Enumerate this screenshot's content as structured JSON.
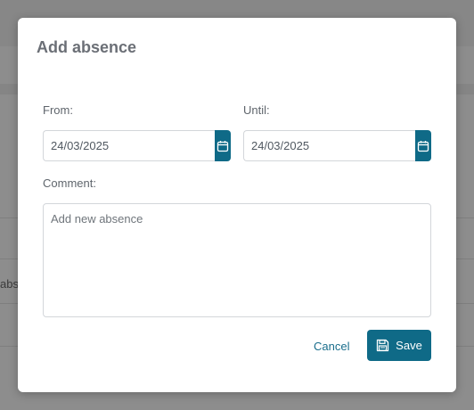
{
  "background": {
    "row_text": "abse"
  },
  "dialog": {
    "title": "Add absence",
    "from": {
      "label": "From:",
      "value": "24/03/2025",
      "button_icon": "calendar-icon"
    },
    "until": {
      "label": "Until:",
      "value": "24/03/2025",
      "button_icon": "calendar-icon"
    },
    "comment": {
      "label": "Comment:",
      "placeholder": "Add new absence"
    },
    "actions": {
      "cancel_label": "Cancel",
      "save_label": "Save",
      "save_icon": "floppy-disk-icon"
    }
  },
  "colors": {
    "accent": "#0f6a87",
    "link": "#1a6e8c",
    "overlay": "#8d8d8d"
  }
}
